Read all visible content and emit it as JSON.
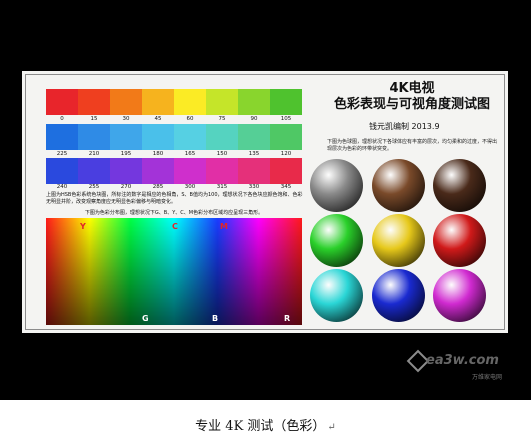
{
  "chart": {
    "title_line1": "4K电视",
    "title_line2": "色彩表现与可视角度测试图",
    "author": "钱元凯编制  2013.9",
    "ball_description": "下图为色球图，理想状况下各球体应有丰富的层次，均匀柔和的过度，不得出现层次为色彩的环带状突变。",
    "rows": [
      {
        "colors": [
          "#e8252b",
          "#ef3f1f",
          "#f27a18",
          "#f6b31e",
          "#fbeb25",
          "#c5e529",
          "#89d52d",
          "#4fc22e"
        ],
        "labels": [
          "0",
          "15",
          "30",
          "45",
          "60",
          "75",
          "90",
          "105"
        ]
      },
      {
        "colors": [
          "#1e6fe0",
          "#2f8be6",
          "#3fa6ea",
          "#4ac0ea",
          "#56d0e3",
          "#55d3c0",
          "#55cf96",
          "#4fc865"
        ],
        "labels": [
          "225",
          "210",
          "195",
          "180",
          "165",
          "150",
          "135",
          "120"
        ]
      },
      {
        "colors": [
          "#2a49de",
          "#4a3ee0",
          "#7437de",
          "#a333d8",
          "#cf2fcc",
          "#e12fa6",
          "#e5307a",
          "#e82a4a"
        ],
        "labels": [
          "240",
          "255",
          "270",
          "285",
          "300",
          "315",
          "330",
          "345"
        ]
      }
    ],
    "hue_description": "上图为HSB色彩系统色块图，所标注的数字是相应的色相角，S、B值均为100，理想状况下各色块应颜色饱和、色彩无明显并阶，改变观察角度应无明显色彩偏移与明暗变化。",
    "hue_caption": "下图为色彩分布图，理想状况下G、B、Y、C、M色彩分布区域均应呈现三角形。",
    "top_letters": [
      {
        "text": "Y",
        "color": "#e0252b"
      },
      {
        "text": "C",
        "color": "#e0252b"
      },
      {
        "text": "M",
        "color": "#e0252b"
      }
    ],
    "bottom_letters": [
      "G",
      "B",
      "R"
    ],
    "balls": [
      {
        "color": "#8a8a8a",
        "name": "gray"
      },
      {
        "color": "#7a4a2a",
        "name": "brown"
      },
      {
        "color": "#4a2a1a",
        "name": "dark-brown"
      },
      {
        "color": "#2ad02a",
        "name": "green"
      },
      {
        "color": "#e6c81a",
        "name": "yellow"
      },
      {
        "color": "#d01a1a",
        "name": "red"
      },
      {
        "color": "#2ad6d6",
        "name": "cyan"
      },
      {
        "color": "#1a2ad0",
        "name": "blue"
      },
      {
        "color": "#d02ad0",
        "name": "magenta"
      }
    ]
  },
  "watermark": {
    "text": "ea3w.com",
    "sub": "万维家电网"
  },
  "caption": {
    "text": "专业 4K 测试（色彩）",
    "mark": "↵"
  }
}
